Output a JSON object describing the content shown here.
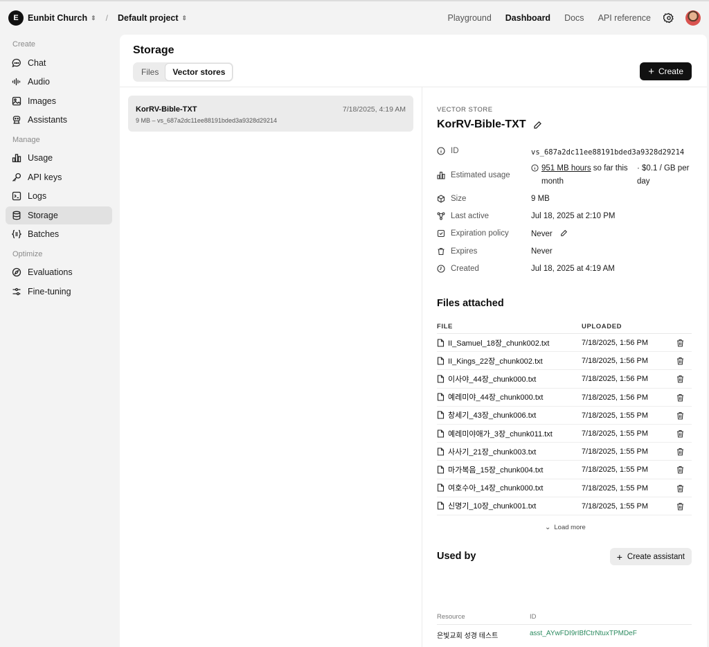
{
  "header": {
    "org_initial": "E",
    "org_name": "Eunbit Church",
    "separator": "/",
    "project": "Default project",
    "nav": [
      "Playground",
      "Dashboard",
      "Docs",
      "API reference"
    ],
    "active_nav": "Dashboard"
  },
  "sidebar": {
    "sections": [
      {
        "title": "Create",
        "items": [
          {
            "label": "Chat",
            "icon": "chat-icon"
          },
          {
            "label": "Audio",
            "icon": "audio-icon"
          },
          {
            "label": "Images",
            "icon": "image-icon"
          },
          {
            "label": "Assistants",
            "icon": "assistant-icon"
          }
        ]
      },
      {
        "title": "Manage",
        "items": [
          {
            "label": "Usage",
            "icon": "chart-icon"
          },
          {
            "label": "API keys",
            "icon": "key-icon"
          },
          {
            "label": "Logs",
            "icon": "terminal-icon"
          },
          {
            "label": "Storage",
            "icon": "database-icon",
            "active": true
          },
          {
            "label": "Batches",
            "icon": "braces-icon"
          }
        ]
      },
      {
        "title": "Optimize",
        "items": [
          {
            "label": "Evaluations",
            "icon": "compass-icon"
          },
          {
            "label": "Fine-tuning",
            "icon": "sliders-icon"
          }
        ]
      }
    ]
  },
  "main": {
    "title": "Storage",
    "tabs": [
      "Files",
      "Vector stores"
    ],
    "active_tab": "Vector stores",
    "create_label": "Create"
  },
  "list": {
    "name": "KorRV-Bible-TXT",
    "date": "7/18/2025, 4:19 AM",
    "sub": "9 MB – vs_687a2dc11ee88191bded3a9328d29214"
  },
  "detail": {
    "kind": "VECTOR STORE",
    "name": "KorRV-Bible-TXT",
    "labels": {
      "id": "ID",
      "usage": "Estimated usage",
      "size": "Size",
      "last_active": "Last active",
      "expiration": "Expiration policy",
      "expires": "Expires",
      "created": "Created"
    },
    "values": {
      "id": "vs_687a2dc11ee88191bded3a9328d29214",
      "usage_link": "951 MB hours",
      "usage_rest": " so far this month",
      "rate": "· $0.1 / GB per day",
      "size": "9 MB",
      "last_active": "Jul 18, 2025 at 2:10 PM",
      "expiration": "Never",
      "expires": "Never",
      "created": "Jul 18, 2025 at 4:19 AM"
    },
    "files_title": "Files attached",
    "file_col": "FILE",
    "uploaded_col": "UPLOADED",
    "files": [
      {
        "name": "II_Samuel_18장_chunk002.txt",
        "date": "7/18/2025, 1:56 PM"
      },
      {
        "name": "II_Kings_22장_chunk002.txt",
        "date": "7/18/2025, 1:56 PM"
      },
      {
        "name": "이사야_44장_chunk000.txt",
        "date": "7/18/2025, 1:56 PM"
      },
      {
        "name": "예레미야_44장_chunk000.txt",
        "date": "7/18/2025, 1:56 PM"
      },
      {
        "name": "창세기_43장_chunk006.txt",
        "date": "7/18/2025, 1:55 PM"
      },
      {
        "name": "예레미야애가_3장_chunk011.txt",
        "date": "7/18/2025, 1:55 PM"
      },
      {
        "name": "사사기_21장_chunk003.txt",
        "date": "7/18/2025, 1:55 PM"
      },
      {
        "name": "마가복음_15장_chunk004.txt",
        "date": "7/18/2025, 1:55 PM"
      },
      {
        "name": "여호수아_14장_chunk000.txt",
        "date": "7/18/2025, 1:55 PM"
      },
      {
        "name": "신명기_10장_chunk001.txt",
        "date": "7/18/2025, 1:55 PM"
      }
    ],
    "load_more": "Load more",
    "used_by_title": "Used by",
    "create_assistant": "Create assistant",
    "resource_col": "Resource",
    "id_col": "ID",
    "used_by": [
      {
        "resource": "은빛교회 성경 테스트",
        "id": "asst_AYwFDI9rIBfCtrNtuxTPMDeF"
      }
    ]
  }
}
